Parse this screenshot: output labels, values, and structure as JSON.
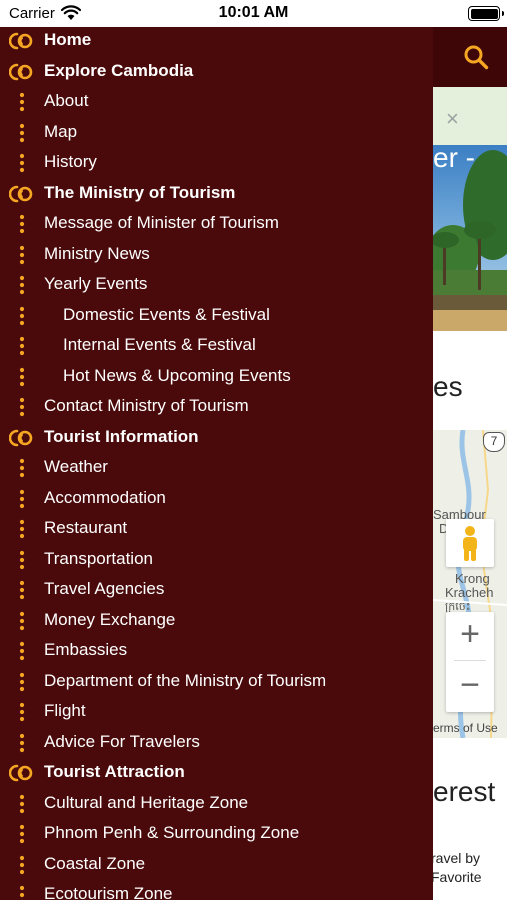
{
  "status_bar": {
    "carrier": "Carrier",
    "time": "10:01 AM"
  },
  "page": {
    "hero_text": "er -",
    "section_title_1": "es",
    "map": {
      "road_badge": "7",
      "place_1": "Sambour",
      "place_1_suffix": "D",
      "place_2_line1": "Krong",
      "place_2_line2": "Kracheh",
      "place_2_line3": "ក្រចេះ",
      "zoom_in": "+",
      "zoom_out": "−",
      "terms": "erms of Use"
    },
    "section_title_2": "erest",
    "promo_line1": "ravel by",
    "promo_line2": "Favorite",
    "toast_close": "×"
  },
  "colors": {
    "drawer_bg": "#4a0a0b",
    "header_bg": "#3f0608",
    "accent": "#f5a623",
    "text": "#ffffff"
  },
  "menu": {
    "items": [
      {
        "label": "Home",
        "level": 0,
        "icon": "swirl-icon"
      },
      {
        "label": "Explore Cambodia",
        "level": 0,
        "icon": "swirl-icon"
      },
      {
        "label": "About",
        "level": 1,
        "icon": "dots-icon"
      },
      {
        "label": "Map",
        "level": 1,
        "icon": "dots-icon"
      },
      {
        "label": "History",
        "level": 1,
        "icon": "dots-icon"
      },
      {
        "label": "The Ministry of Tourism",
        "level": 0,
        "icon": "swirl-icon"
      },
      {
        "label": "Message of Minister of Tourism",
        "level": 1,
        "icon": "dots-icon"
      },
      {
        "label": "Ministry News",
        "level": 1,
        "icon": "dots-icon"
      },
      {
        "label": "Yearly Events",
        "level": 1,
        "icon": "dots-icon"
      },
      {
        "label": "Domestic Events & Festival",
        "level": 2,
        "icon": "dots-icon"
      },
      {
        "label": "Internal Events & Festival",
        "level": 2,
        "icon": "dots-icon"
      },
      {
        "label": "Hot News & Upcoming Events",
        "level": 2,
        "icon": "dots-icon"
      },
      {
        "label": "Contact Ministry of Tourism",
        "level": 1,
        "icon": "dots-icon"
      },
      {
        "label": "Tourist Information",
        "level": 0,
        "icon": "swirl-icon"
      },
      {
        "label": "Weather",
        "level": 1,
        "icon": "dots-icon"
      },
      {
        "label": "Accommodation",
        "level": 1,
        "icon": "dots-icon"
      },
      {
        "label": "Restaurant",
        "level": 1,
        "icon": "dots-icon"
      },
      {
        "label": "Transportation",
        "level": 1,
        "icon": "dots-icon"
      },
      {
        "label": "Travel Agencies",
        "level": 1,
        "icon": "dots-icon"
      },
      {
        "label": "Money Exchange",
        "level": 1,
        "icon": "dots-icon"
      },
      {
        "label": "Embassies",
        "level": 1,
        "icon": "dots-icon"
      },
      {
        "label": "Department of the Ministry of Tourism",
        "level": 1,
        "icon": "dots-icon"
      },
      {
        "label": "Flight",
        "level": 1,
        "icon": "dots-icon"
      },
      {
        "label": "Advice For Travelers",
        "level": 1,
        "icon": "dots-icon"
      },
      {
        "label": "Tourist Attraction",
        "level": 0,
        "icon": "swirl-icon"
      },
      {
        "label": "Cultural and Heritage Zone",
        "level": 1,
        "icon": "dots-icon"
      },
      {
        "label": "Phnom Penh & Surrounding Zone",
        "level": 1,
        "icon": "dots-icon"
      },
      {
        "label": "Coastal Zone",
        "level": 1,
        "icon": "dots-icon"
      },
      {
        "label": "Ecotourism Zone",
        "level": 1,
        "icon": "dots-icon"
      }
    ]
  }
}
